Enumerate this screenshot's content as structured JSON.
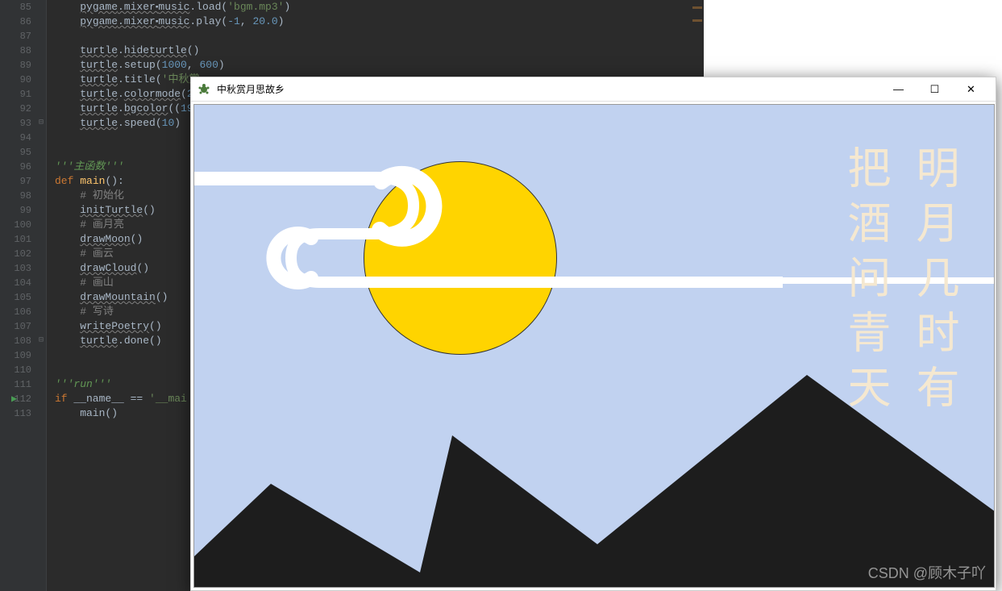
{
  "gutter": {
    "start": 85,
    "end": 113,
    "playLine": 112,
    "foldLines": [
      93,
      108
    ]
  },
  "code": {
    "lines": [
      {
        "n": 85,
        "parts": [
          {
            "t": "    ",
            "c": ""
          },
          {
            "t": "pygame",
            "c": "warn ident"
          },
          {
            "t": ".mixer⬝",
            "c": "warn ident"
          },
          {
            "t": "music",
            "c": "warn ident"
          },
          {
            "t": ".load(",
            "c": ""
          },
          {
            "t": "'bgm.mp3'",
            "c": "str"
          },
          {
            "t": ")",
            "c": ""
          }
        ]
      },
      {
        "n": 86,
        "parts": [
          {
            "t": "    ",
            "c": ""
          },
          {
            "t": "pygame",
            "c": "warn ident"
          },
          {
            "t": ".mixer⬝",
            "c": "warn ident"
          },
          {
            "t": "music",
            "c": "warn ident"
          },
          {
            "t": ".play(",
            "c": ""
          },
          {
            "t": "-1",
            "c": "num"
          },
          {
            "t": ", ",
            "c": ""
          },
          {
            "t": "20.0",
            "c": "num"
          },
          {
            "t": ")",
            "c": ""
          }
        ]
      },
      {
        "n": 87,
        "parts": []
      },
      {
        "n": 88,
        "parts": [
          {
            "t": "    ",
            "c": ""
          },
          {
            "t": "turtle",
            "c": "warn ident"
          },
          {
            "t": ".",
            "c": ""
          },
          {
            "t": "hideturtle",
            "c": "warn"
          },
          {
            "t": "()",
            "c": ""
          }
        ]
      },
      {
        "n": 89,
        "parts": [
          {
            "t": "    ",
            "c": ""
          },
          {
            "t": "turtle",
            "c": "warn ident"
          },
          {
            "t": ".setup(",
            "c": ""
          },
          {
            "t": "1000",
            "c": "num"
          },
          {
            "t": ", ",
            "c": ""
          },
          {
            "t": "600",
            "c": "num"
          },
          {
            "t": ")",
            "c": ""
          }
        ]
      },
      {
        "n": 90,
        "parts": [
          {
            "t": "    ",
            "c": ""
          },
          {
            "t": "turtle",
            "c": "warn ident"
          },
          {
            "t": ".title(",
            "c": ""
          },
          {
            "t": "'中秋赏",
            "c": "str"
          }
        ]
      },
      {
        "n": 91,
        "parts": [
          {
            "t": "    ",
            "c": ""
          },
          {
            "t": "turtle",
            "c": "warn ident"
          },
          {
            "t": ".",
            "c": ""
          },
          {
            "t": "colormode",
            "c": "warn"
          },
          {
            "t": "(",
            "c": ""
          },
          {
            "t": "2",
            "c": "num"
          }
        ]
      },
      {
        "n": 92,
        "parts": [
          {
            "t": "    ",
            "c": ""
          },
          {
            "t": "turtle",
            "c": "warn ident"
          },
          {
            "t": ".",
            "c": ""
          },
          {
            "t": "bgcolor",
            "c": "warn"
          },
          {
            "t": "((",
            "c": ""
          },
          {
            "t": "19",
            "c": "num"
          }
        ]
      },
      {
        "n": 93,
        "parts": [
          {
            "t": "    ",
            "c": ""
          },
          {
            "t": "turtle",
            "c": "warn ident"
          },
          {
            "t": ".speed(",
            "c": ""
          },
          {
            "t": "10",
            "c": "num"
          },
          {
            "t": ")",
            "c": ""
          }
        ]
      },
      {
        "n": 94,
        "parts": []
      },
      {
        "n": 95,
        "parts": []
      },
      {
        "n": 96,
        "parts": [
          {
            "t": "'''主函数'''",
            "c": "doccomment"
          }
        ]
      },
      {
        "n": 97,
        "parts": [
          {
            "t": "def ",
            "c": "kw"
          },
          {
            "t": "main",
            "c": "fn"
          },
          {
            "t": "():",
            "c": ""
          }
        ]
      },
      {
        "n": 98,
        "parts": [
          {
            "t": "    ",
            "c": ""
          },
          {
            "t": "# 初始化",
            "c": "comment"
          }
        ]
      },
      {
        "n": 99,
        "parts": [
          {
            "t": "    ",
            "c": ""
          },
          {
            "t": "initTurtle",
            "c": "warn"
          },
          {
            "t": "()",
            "c": ""
          }
        ]
      },
      {
        "n": 100,
        "parts": [
          {
            "t": "    ",
            "c": ""
          },
          {
            "t": "# 画月亮",
            "c": "comment"
          }
        ]
      },
      {
        "n": 101,
        "parts": [
          {
            "t": "    ",
            "c": ""
          },
          {
            "t": "drawMoon",
            "c": "warn"
          },
          {
            "t": "()",
            "c": ""
          }
        ]
      },
      {
        "n": 102,
        "parts": [
          {
            "t": "    ",
            "c": ""
          },
          {
            "t": "# 画云",
            "c": "comment"
          }
        ]
      },
      {
        "n": 103,
        "parts": [
          {
            "t": "    ",
            "c": ""
          },
          {
            "t": "drawCloud",
            "c": "warn"
          },
          {
            "t": "()",
            "c": ""
          }
        ]
      },
      {
        "n": 104,
        "parts": [
          {
            "t": "    ",
            "c": ""
          },
          {
            "t": "# 画山",
            "c": "comment"
          }
        ]
      },
      {
        "n": 105,
        "parts": [
          {
            "t": "    ",
            "c": ""
          },
          {
            "t": "drawMountain",
            "c": "warn"
          },
          {
            "t": "()",
            "c": ""
          }
        ]
      },
      {
        "n": 106,
        "parts": [
          {
            "t": "    ",
            "c": ""
          },
          {
            "t": "# 写诗",
            "c": "comment"
          }
        ]
      },
      {
        "n": 107,
        "parts": [
          {
            "t": "    ",
            "c": ""
          },
          {
            "t": "writePoetry",
            "c": "warn"
          },
          {
            "t": "()",
            "c": ""
          }
        ]
      },
      {
        "n": 108,
        "parts": [
          {
            "t": "    ",
            "c": ""
          },
          {
            "t": "turtle",
            "c": "warn ident"
          },
          {
            "t": ".done()",
            "c": ""
          }
        ]
      },
      {
        "n": 109,
        "parts": []
      },
      {
        "n": 110,
        "parts": []
      },
      {
        "n": 111,
        "parts": [
          {
            "t": "'''run'''",
            "c": "doccomment"
          }
        ]
      },
      {
        "n": 112,
        "parts": [
          {
            "t": "if ",
            "c": "kw"
          },
          {
            "t": "__name__",
            "c": "ident"
          },
          {
            "t": " == ",
            "c": ""
          },
          {
            "t": "'__mai",
            "c": "str"
          }
        ]
      },
      {
        "n": 113,
        "parts": [
          {
            "t": "    main()",
            "c": ""
          }
        ]
      }
    ]
  },
  "turtle": {
    "title": "中秋赏月思故乡",
    "controls": {
      "min": "—",
      "max": "☐",
      "close": "✕"
    },
    "poetry": {
      "right": "明月几时有",
      "left": "把酒问青天"
    }
  },
  "watermark": "CSDN @顾木子吖"
}
